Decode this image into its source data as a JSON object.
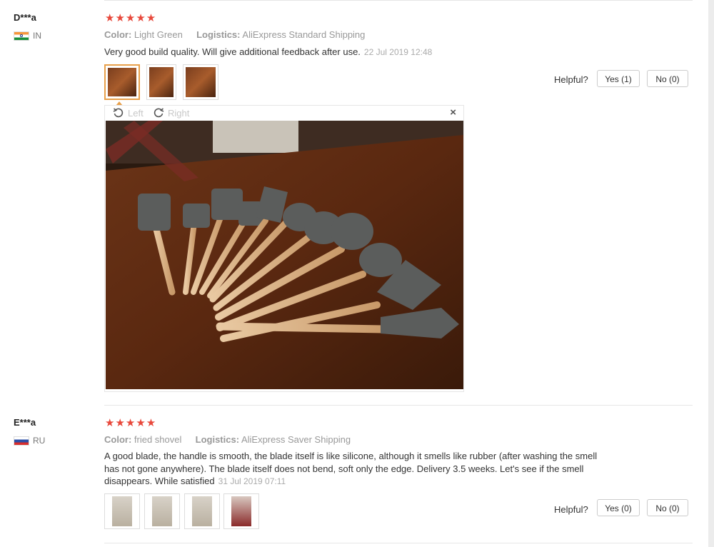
{
  "reviews": [
    {
      "user": "D***a",
      "country": "IN",
      "stars": "★★★★★",
      "color_label": "Color:",
      "color_value": "Light Green",
      "logistics_label": "Logistics:",
      "logistics_value": "AliExpress Standard Shipping",
      "text": "Very good build quality. Will give additional feedback after use.",
      "date": "22 Jul 2019 12:48",
      "helpful_label": "Helpful?",
      "yes_label": "Yes (1)",
      "no_label": "No (0)"
    },
    {
      "user": "E***a",
      "country": "RU",
      "stars": "★★★★★",
      "color_label": "Color:",
      "color_value": "fried shovel",
      "logistics_label": "Logistics:",
      "logistics_value": "AliExpress Saver Shipping",
      "text": "A good blade, the handle is smooth, the blade itself is like silicone, although it smells like rubber (after washing the smell has not gone anywhere). The blade itself does not bend, soft only the edge. Delivery 3.5 weeks. Let's see if the smell disappears. While satisfied",
      "date": "31 Jul 2019 07:11",
      "helpful_label": "Helpful?",
      "yes_label": "Yes (0)",
      "no_label": "No (0)"
    }
  ],
  "viewer": {
    "rotate_left": "Left",
    "rotate_right": "Right",
    "close": "×"
  },
  "colors": {
    "star": "#e8483b",
    "active_thumb": "#e8a04a"
  }
}
